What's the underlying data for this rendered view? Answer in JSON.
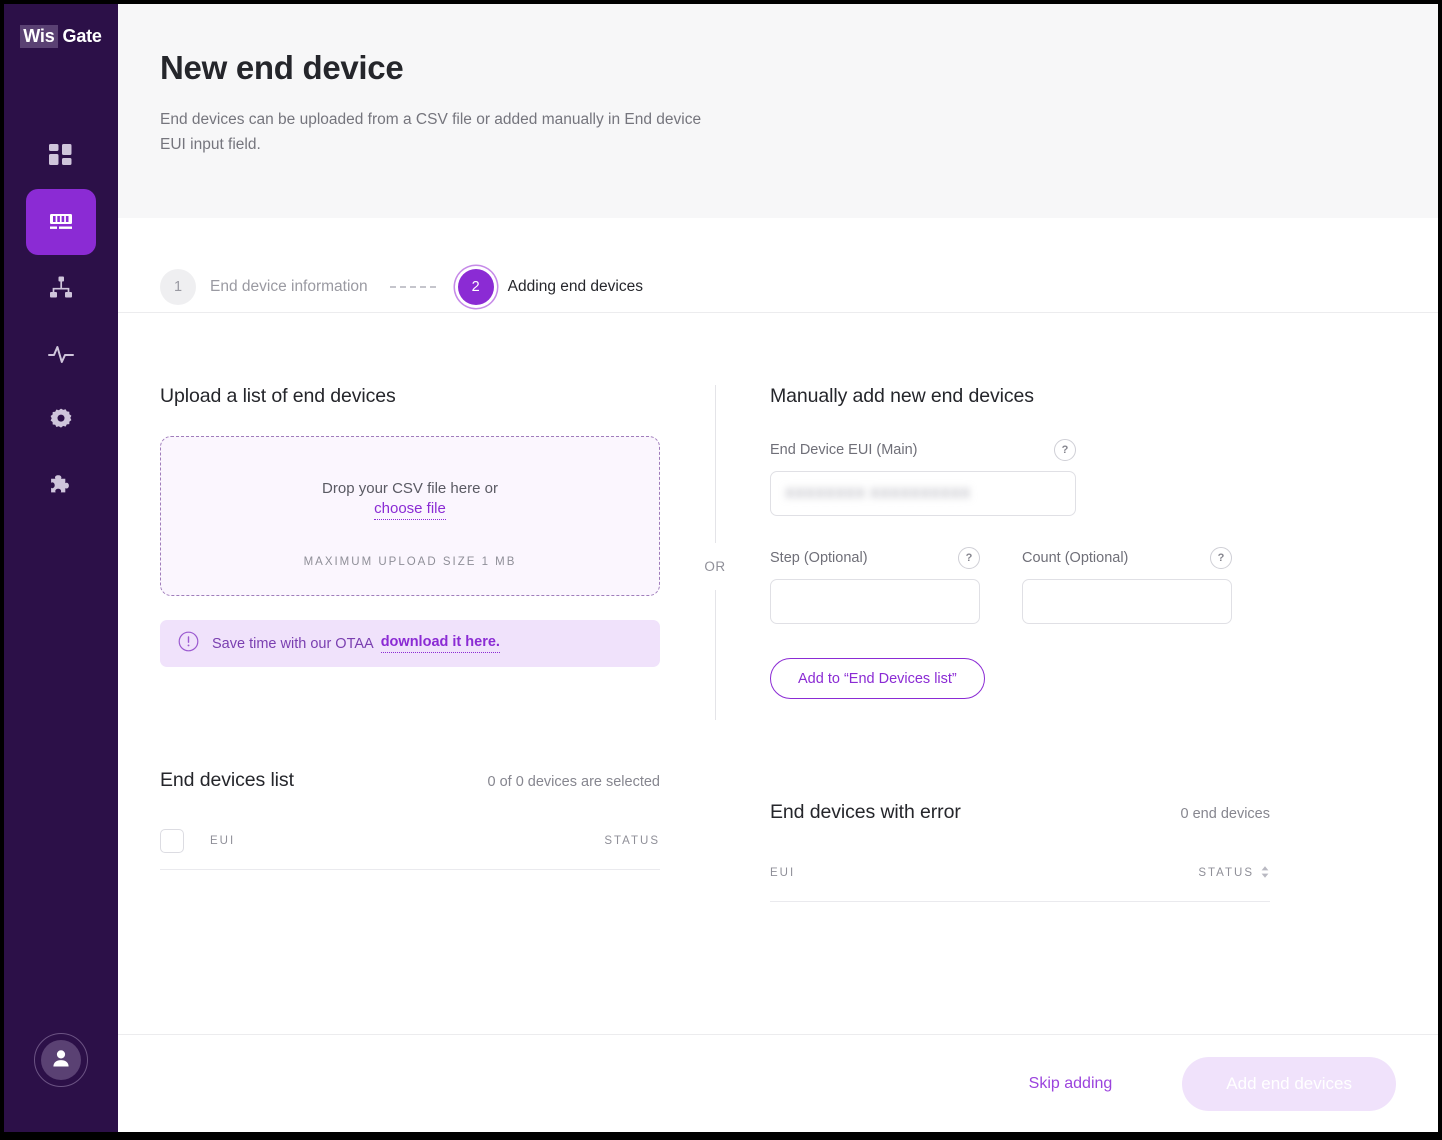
{
  "brand": {
    "name_part1": "Wis",
    "name_part2": "Gate"
  },
  "sidebar": {
    "items": [
      {
        "icon": "dashboard-icon",
        "name": "sidebar-item-dashboard",
        "active": false
      },
      {
        "icon": "devices-icon",
        "name": "sidebar-item-devices",
        "active": true
      },
      {
        "icon": "network-icon",
        "name": "sidebar-item-network",
        "active": false
      },
      {
        "icon": "activity-icon",
        "name": "sidebar-item-activity",
        "active": false
      },
      {
        "icon": "gear-icon",
        "name": "sidebar-item-settings",
        "active": false
      },
      {
        "icon": "puzzle-icon",
        "name": "sidebar-item-plugins",
        "active": false
      }
    ],
    "avatar_icon": "user-avatar-icon"
  },
  "header": {
    "title": "New end device",
    "subtitle": "End devices can be uploaded from a CSV file or added manually in End device EUI input field."
  },
  "stepper": {
    "steps": [
      {
        "number": "1",
        "label": "End device information",
        "state": "inactive"
      },
      {
        "number": "2",
        "label": "Adding end devices",
        "state": "active"
      }
    ]
  },
  "upload": {
    "title": "Upload a list of end devices",
    "drop_text": "Drop your CSV file here or",
    "choose_file_link": "choose file",
    "max_size_note": "MAXIMUM UPLOAD SIZE 1 MB",
    "banner": {
      "icon": "exclamation-circle-icon",
      "text": "Save time with our OTAA",
      "link": "download it here."
    }
  },
  "divider": {
    "label": "OR"
  },
  "manual": {
    "title": "Manually add new end devices",
    "eui": {
      "label": "End Device EUI (Main)",
      "help_icon": "question-mark-icon",
      "value": "XXXXXXXX XXXXXXXXXX",
      "placeholder": ""
    },
    "step": {
      "label": "Step (Optional)",
      "help_icon": "question-mark-icon",
      "value": "",
      "placeholder": ""
    },
    "count": {
      "label": "Count (Optional)",
      "help_icon": "question-mark-icon",
      "value": "",
      "placeholder": ""
    },
    "add_button": "Add to “End Devices list”"
  },
  "devices_list": {
    "title": "End devices list",
    "count_text": "0 of 0 devices are selected",
    "columns": {
      "eui": "EUI",
      "status": "STATUS"
    },
    "rows": []
  },
  "devices_error": {
    "title": "End devices with error",
    "count_text": "0 end devices",
    "columns": {
      "eui": "EUI",
      "status": "STATUS"
    },
    "sort_icon": "sort-arrows-icon",
    "rows": []
  },
  "footer": {
    "skip_label": "Skip adding",
    "primary_label": "Add end devices"
  },
  "colors": {
    "sidebar_bg": "#2c1048",
    "accent": "#8b2bd4",
    "accent_light": "#f0e2fb",
    "dropzone_bg": "#fbf6fe",
    "header_bg": "#f7f7f8",
    "text_dark": "#25262b",
    "text_muted": "#8f8f98"
  }
}
